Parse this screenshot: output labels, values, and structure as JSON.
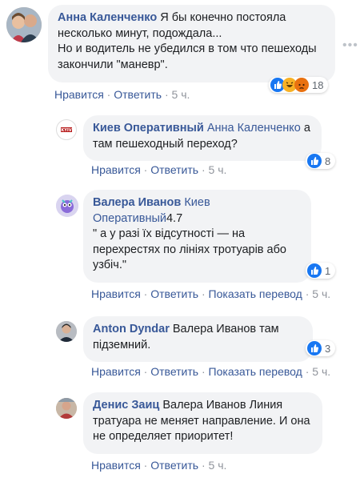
{
  "comments": [
    {
      "author": "Анна Каленченко",
      "text1": " Я бы конечно постояла",
      "text2": "несколько минут, подождала...",
      "text3": "Но и водитель не убедился в том что пешеходы",
      "text4": "закончили \"маневр\".",
      "like": "Нравится",
      "reply": "Ответить",
      "time": "5 ч.",
      "reactions": "18"
    },
    {
      "author": "Киев Оперативный",
      "mention": "Анна Каленченко",
      "text1": " а",
      "text2": "там пешеходный переход?",
      "like": "Нравится",
      "reply": "Ответить",
      "time": "5 ч.",
      "reactions": "8"
    },
    {
      "author": "Валера Иванов",
      "mention1": "Киев",
      "mention2": "Оперативный",
      "text1": "4.7",
      "text2": "\" а у разі їх відсутності — на",
      "text3": "перехрестях по лініях тротуарів або",
      "text4": "узбіч.\"",
      "like": "Нравится",
      "reply": "Ответить",
      "translate": "Показать перевод",
      "time": "5 ч.",
      "reactions": "1"
    },
    {
      "author": "Anton Dyndar",
      "text1": " Валера Иванов там",
      "text2": "підземний.",
      "like": "Нравится",
      "reply": "Ответить",
      "translate": "Показать перевод",
      "time": "5 ч.",
      "reactions": "3"
    },
    {
      "author": "Денис Заиц",
      "text1": " Валера Иванов Линия",
      "text2": "тратуара не меняет направление. И она",
      "text3": "не определяет приоритет!",
      "like": "Нравится",
      "reply": "Ответить",
      "time": "5 ч."
    }
  ],
  "more_icon": "•••",
  "icons": [
    "like-icon",
    "haha-icon",
    "angry-icon"
  ],
  "colors": {
    "link": "#385898",
    "bubble": "#f2f3f5",
    "like": "#1877f2"
  }
}
